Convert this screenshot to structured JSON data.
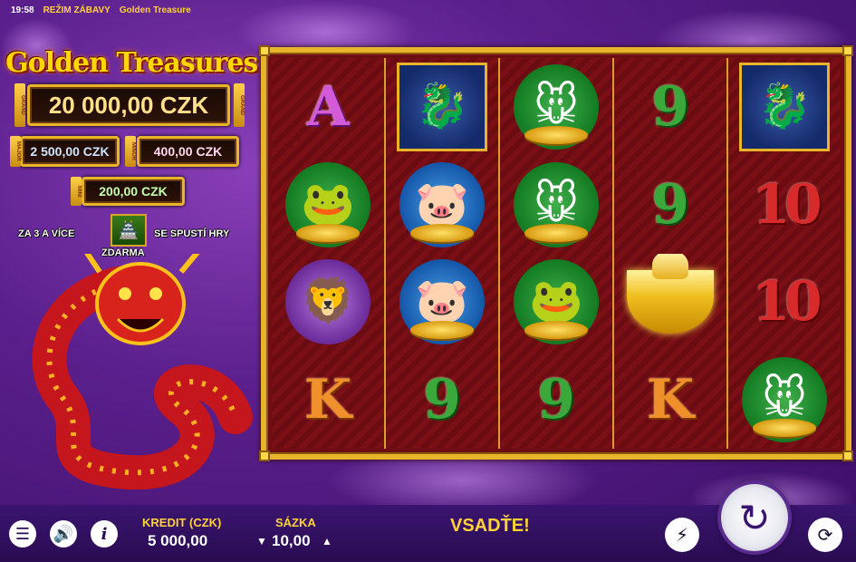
{
  "status_bar": {
    "time": "19:58",
    "mode": "REŽIM ZÁBAVY",
    "game_name": "Golden Treasure"
  },
  "logo": "Golden Treasures",
  "jackpots": {
    "grand": {
      "tag": "GRAND",
      "value": "20 000,00 CZK"
    },
    "major": {
      "tag": "MAJOR",
      "value": "2 500,00 CZK"
    },
    "minor": {
      "tag": "MINOR",
      "value": "400,00 CZK"
    },
    "mini": {
      "tag": "MINI",
      "value": "200,00 CZK"
    }
  },
  "bonus_info": {
    "left": "ZA 3 A VÍCE",
    "right": "SE SPUSTÍ HRY",
    "bottom": "ZDARMA"
  },
  "reels": [
    [
      "A",
      "frog",
      "lion-dog",
      "K"
    ],
    [
      "dragon",
      "pig",
      "pig",
      "9"
    ],
    [
      "rat",
      "rat",
      "frog",
      "9"
    ],
    [
      "9",
      "9",
      "ingot",
      "K"
    ],
    [
      "dragon",
      "10",
      "10",
      "rat"
    ]
  ],
  "symbol_icons": {
    "frog": "frog-icon",
    "lion-dog": "lion-dog-icon",
    "dragon": "dragon-icon",
    "pig": "pig-icon",
    "rat": "rat-icon",
    "ingot": "gold-ingot-icon"
  },
  "bottom_bar": {
    "credit_label": "KREDIT (CZK)",
    "credit_value": "5 000,00",
    "bet_label": "SÁZKA",
    "bet_value": "10,00",
    "place_bet": "VSADŤE!"
  },
  "colors": {
    "accent": "#ffd23a",
    "frame": "#e8b42a",
    "background": "#5a1f8c",
    "bottom_bar": "#2a0c52"
  }
}
